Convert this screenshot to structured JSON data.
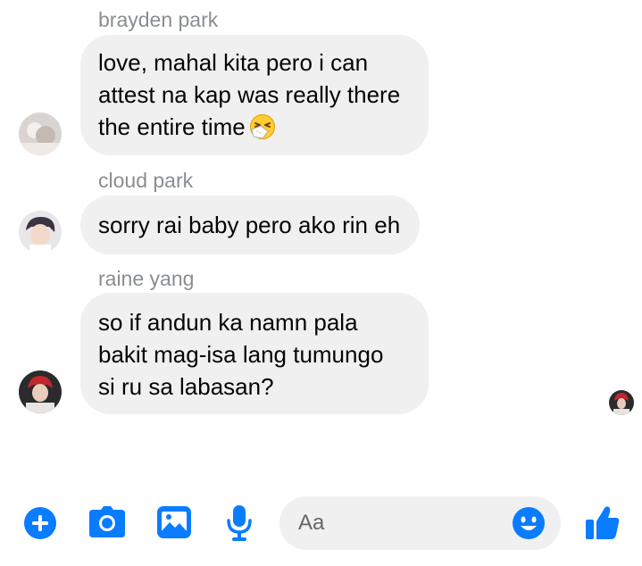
{
  "messages": [
    {
      "sender": "brayden park",
      "lines": [
        "love, mahal kita pero i can",
        "attest na kap was really there",
        "the entire time"
      ],
      "trailing_emoji": "sneezing-face-emoji"
    },
    {
      "sender": "cloud park",
      "lines": [
        "sorry rai baby pero ako rin eh"
      ]
    },
    {
      "sender": "raine yang",
      "lines": [
        "so if andun ka namn pala",
        "bakit mag-isa lang tumungo",
        "si ru sa labasan?"
      ]
    }
  ],
  "composer": {
    "placeholder": "Aa"
  },
  "toolbar": {
    "icons": [
      "plus-icon",
      "camera-icon",
      "image-icon",
      "microphone-icon",
      "emoji-icon",
      "thumbs-up-icon"
    ]
  },
  "colors": {
    "accent": "#0a7cff",
    "bubble": "#f0f0f0",
    "sender_name": "#8a8d91",
    "text": "#050505",
    "placeholder": "#65676b"
  }
}
